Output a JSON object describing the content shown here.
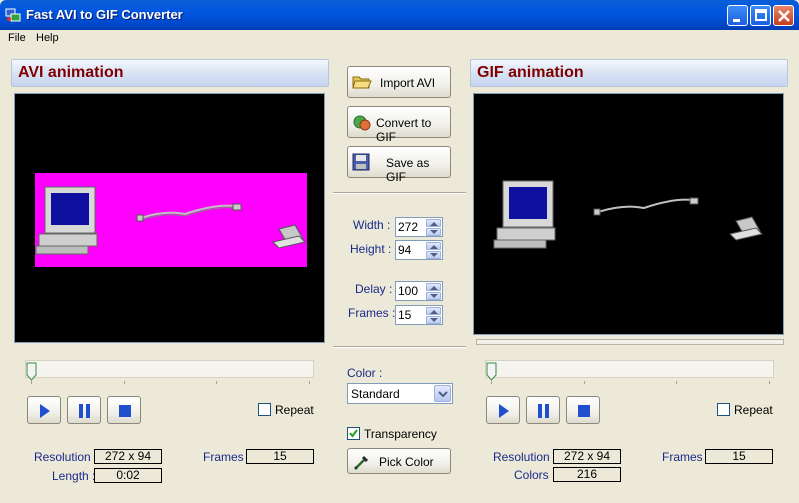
{
  "window": {
    "title": "Fast AVI to GIF Converter"
  },
  "menu": {
    "file": "File",
    "help": "Help"
  },
  "avi_panel": {
    "header": "AVI animation",
    "repeat_label": "Repeat",
    "repeat_checked": false,
    "resolution_label": "Resolution :",
    "resolution_value": "272 x 94",
    "length_label": "Length :",
    "length_value": "0:02",
    "frames_label": "Frames :",
    "frames_value": "15",
    "preview_background": "#ff00ff"
  },
  "gif_panel": {
    "header": "GIF animation",
    "repeat_label": "Repeat",
    "repeat_checked": false,
    "resolution_label": "Resolution :",
    "resolution_value": "272 x 94",
    "colors_label": "Colors :",
    "colors_value": "216",
    "frames_label": "Frames :",
    "frames_value": "15"
  },
  "actions": {
    "import": "Import AVI",
    "convert": "Convert to GIF",
    "save": "Save as GIF"
  },
  "settings": {
    "width_label": "Width :",
    "width_value": "272",
    "height_label": "Height :",
    "height_value": "94",
    "delay_label": "Delay :",
    "delay_value": "100",
    "frames_label": "Frames :",
    "frames_value": "15",
    "color_label": "Color :",
    "color_value": "Standard",
    "transparency_label": "Transparency",
    "transparency_checked": true,
    "pick_color": "Pick Color"
  },
  "colors": {
    "title_bar": "#0055e5",
    "panel_header_text": "#800000",
    "label_text": "#1a2a8a",
    "accent_blue": "#1f4fcf"
  },
  "icons": [
    "app-icon",
    "minimize-icon",
    "maximize-icon",
    "close-icon",
    "folder-open-icon",
    "convert-icon",
    "floppy-disk-icon",
    "play-icon",
    "pause-icon",
    "stop-icon",
    "eyedropper-icon"
  ]
}
